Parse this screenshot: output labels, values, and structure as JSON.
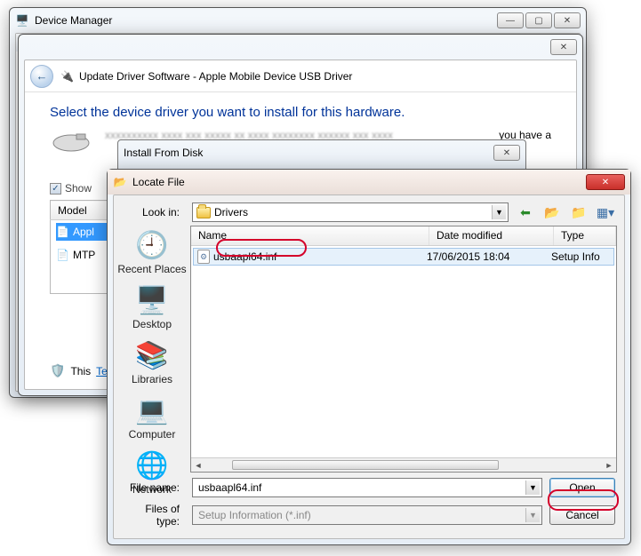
{
  "device_manager": {
    "title": "Device Manager"
  },
  "wizard": {
    "title": "Update Driver Software - Apple Mobile Device USB Driver",
    "heading": "Select the device driver you want to install for this hardware.",
    "hint_fragment": "you have a",
    "show_compat_label": "Show",
    "model_col": "Model",
    "models": [
      "Appl",
      "MTP"
    ],
    "signed_prefix": "This",
    "tell_me_link": "Tell m"
  },
  "install_from_disk": {
    "title": "Install From Disk"
  },
  "locate": {
    "title": "Locate File",
    "lookin_label": "Look in:",
    "lookin_value": "Drivers",
    "toolbar_icons": [
      "back-icon",
      "up-icon",
      "new-folder-icon",
      "views-icon"
    ],
    "places": [
      "Recent Places",
      "Desktop",
      "Libraries",
      "Computer",
      "Network"
    ],
    "columns": {
      "name": "Name",
      "date": "Date modified",
      "type": "Type"
    },
    "file": {
      "name": "usbaapl64.inf",
      "date": "17/06/2015 18:04",
      "type": "Setup Info"
    },
    "filename_label": "File name:",
    "filename_value": "usbaapl64.inf",
    "filetype_label": "Files of type:",
    "filetype_value": "Setup Information (*.inf)",
    "open_btn": "Open",
    "cancel_btn": "Cancel"
  }
}
